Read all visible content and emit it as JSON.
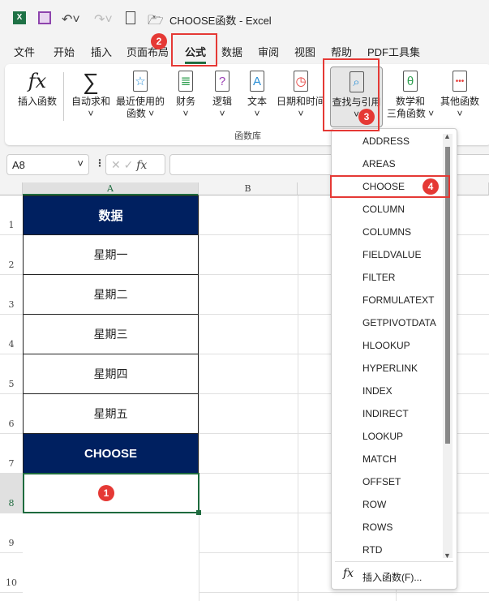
{
  "titlebar": {
    "title": "CHOOSE函数  -  Excel"
  },
  "tabs": [
    "文件",
    "开始",
    "插入",
    "页面布局",
    "公式",
    "数据",
    "审阅",
    "视图",
    "帮助",
    "PDF工具集"
  ],
  "active_tab": "公式",
  "ribbon": {
    "insert_function": "插入函数",
    "autosum": "自动求和",
    "recent_1": "最近使用的",
    "recent_2": "函数",
    "financial": "财务",
    "logical": "逻辑",
    "text": "文本",
    "datetime": "日期和时间",
    "lookup": "查找与引用",
    "math_1": "数学和",
    "math_2": "三角函数",
    "more": "其他函数",
    "group_label": "函数库"
  },
  "formula_bar": {
    "name_box": "A8",
    "formula": ""
  },
  "columns": [
    "A",
    "B"
  ],
  "rows": [
    "1",
    "2",
    "3",
    "4",
    "5",
    "6",
    "7",
    "8",
    "9",
    "10"
  ],
  "cells": [
    "数据",
    "星期一",
    "星期二",
    "星期三",
    "星期四",
    "星期五",
    "CHOOSE",
    ""
  ],
  "dropdown": {
    "items": [
      "ADDRESS",
      "AREAS",
      "CHOOSE",
      "COLUMN",
      "COLUMNS",
      "FIELDVALUE",
      "FILTER",
      "FORMULATEXT",
      "GETPIVOTDATA",
      "HLOOKUP",
      "HYPERLINK",
      "INDEX",
      "INDIRECT",
      "LOOKUP",
      "MATCH",
      "OFFSET",
      "ROW",
      "ROWS",
      "RTD"
    ],
    "footer": "插入函数(F)..."
  },
  "badges": [
    "1",
    "2",
    "3",
    "4"
  ],
  "colors": {
    "header_fill": "#002060",
    "accent": "#1e6b3e",
    "highlight": "#e53935"
  }
}
